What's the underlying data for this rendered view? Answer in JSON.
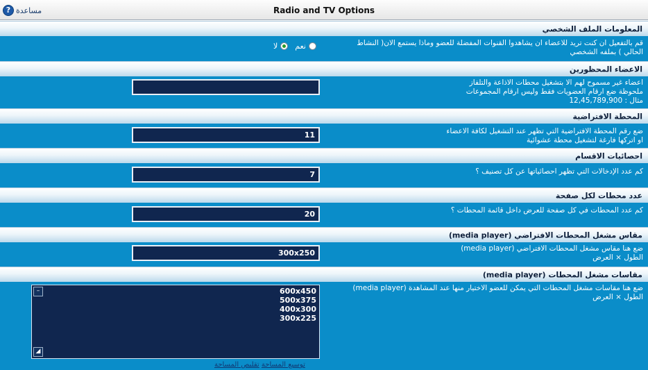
{
  "window": {
    "title": "Radio and TV Options",
    "help_label": "مساعدة",
    "help_icon": "?"
  },
  "sections": {
    "profile": {
      "header": "المعلومات الملف الشخصي",
      "desc": "قم بالتفعيل ان كنت تريد للاعضاء ان يشاهدوا القنوات المفضلة للعضو وماذا يستمع الان( النشاط الحالي ) بملفه الشخصي",
      "yes_label": "نعم",
      "no_label": "لا"
    },
    "banned": {
      "header": "الاعضاء المحظورين",
      "desc1": "اعضاء غير مسموح لهم الا بتشغيل محطات الاذاعة والتلفاز",
      "desc2": "ملحوظة ضع ارقام العضويات فقط وليس ارقام المجموعات",
      "desc3": "مثال : 12,45,789,900",
      "value": ""
    },
    "default_station": {
      "header": "المحطة الافتراضية",
      "desc1": "ضع رقم المحطة الافتراضية التي تظهر عند التشغيل لكافة الاعضاء",
      "desc2": "او اتركها فارغة لتشغيل محطة عشوائية",
      "value": "11"
    },
    "section_stats": {
      "header": "احصائيات الاقسام",
      "desc": "كم عدد الإدخالات التي تظهر احصائياتها عن كل تصنيف ؟",
      "value": "7"
    },
    "stations_per_page": {
      "header": "عدد محطات لكل صفحة",
      "desc": "كم عدد المحطات في كل صفحة للعرض داخل قائمة المحطات ؟",
      "value": "20"
    },
    "default_player_size": {
      "header": "مقاس مشغل المحطات الافتراضي (media player)",
      "desc1": "ضع هنا مقاس مشغل المحطات الافتراضي (media player)",
      "desc2": "الطول × العرض",
      "value": "300x250"
    },
    "player_sizes": {
      "header": "مقاسات مشغل المحطات (media player)",
      "desc1": "ضع هنا مقاسات مشغل المحطات التي يمكن للعضو الاختيار منها عند المشاهدة (media player)",
      "desc2": "الطول × العرض",
      "values": [
        "600x450",
        "500x375",
        "400x300",
        "300x225"
      ],
      "expand_label": "توسيع المساحة",
      "shrink_label": "تقليص المساحة"
    }
  }
}
